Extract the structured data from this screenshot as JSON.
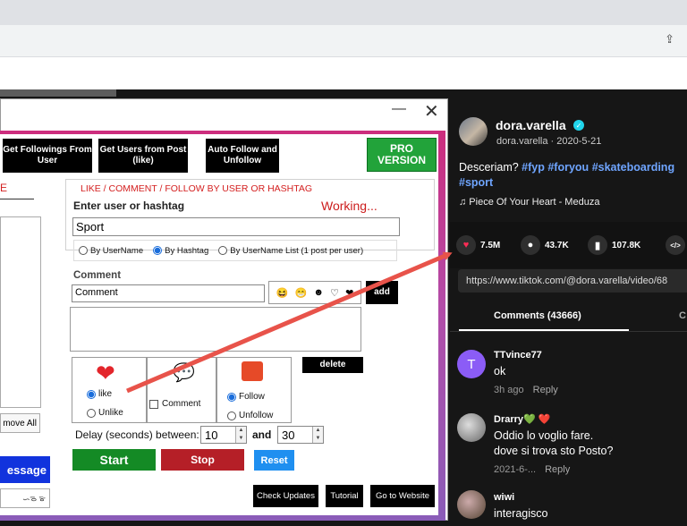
{
  "browser": {
    "ext_icon": "share-icon"
  },
  "window": {
    "min_glyph": "—",
    "close_glyph": "✕"
  },
  "toolbar": {
    "get_followings": "Get Followings From User",
    "get_users_post": "Get Users from Post (like)",
    "auto_follow": "Auto Follow and Unfollow",
    "pro": "PRO VERSION"
  },
  "left": {
    "tab_partial": "E",
    "remove_all": "move All",
    "message": "essage",
    "small_text": "ᯈᯉ ᯊ"
  },
  "form": {
    "group_title": "LIKE / COMMENT / FOLLOW BY USER OR HASHTAG",
    "enter_label": "Enter user or hashtag",
    "status": "Working...",
    "user_value": "Sport",
    "radio_username": "By UserName",
    "radio_hashtag": "By Hashtag",
    "radio_list": "By UserName List (1 post per user)",
    "comment_label": "Comment",
    "comment_value": "Comment",
    "emojis": [
      "😆",
      "😁",
      "☻",
      "♡",
      "❤"
    ],
    "add": "add",
    "like": "like",
    "unlike": "Unlike",
    "comment_opt": "Comment",
    "follow": "Follow",
    "unfollow": "Unfollow",
    "delete": "delete",
    "delay_label": "Delay (seconds) between:",
    "delay_min": "10",
    "and": "and",
    "delay_max": "30",
    "start": "Start",
    "stop": "Stop",
    "reset": "Reset",
    "check_updates": "Check Updates",
    "tutorial": "Tutorial",
    "go_website": "Go to Website"
  },
  "tiktok": {
    "username": "dora.varella",
    "subline": "dora.varella · 2020-5-21",
    "desc_text": "Desceriam?",
    "tags": [
      "#fyp",
      "#foryou",
      "#skateboarding",
      "#sport"
    ],
    "music": "♫  Piece Of Your Heart - Meduza",
    "likes": "7.5M",
    "comments_count": "43.7K",
    "saves": "107.8K",
    "url": "https://www.tiktok.com/@dora.varella/video/68",
    "tab_comments": "Comments (43666)",
    "tab_other": "C",
    "comments": [
      {
        "avatar": "T",
        "name": "TTvince77",
        "text": "ok",
        "time": "3h ago",
        "reply": "Reply"
      },
      {
        "name": "Drarry💚 ❤️",
        "text": "Oddio lo voglio fare.",
        "text2": "dove si trova sto Posto?",
        "time": "2021-6-...",
        "reply": "Reply"
      },
      {
        "name": "wiwi",
        "text": "interagisco"
      }
    ]
  },
  "colors": {
    "frame_top": "#cc2d7d",
    "frame_bottom": "#8a5cb8",
    "arrow": "#e8534a",
    "start": "#148a25",
    "stop": "#b51f27",
    "reset": "#1f8ff0",
    "pro": "#22a33a",
    "tag": "#6fa5ff"
  }
}
